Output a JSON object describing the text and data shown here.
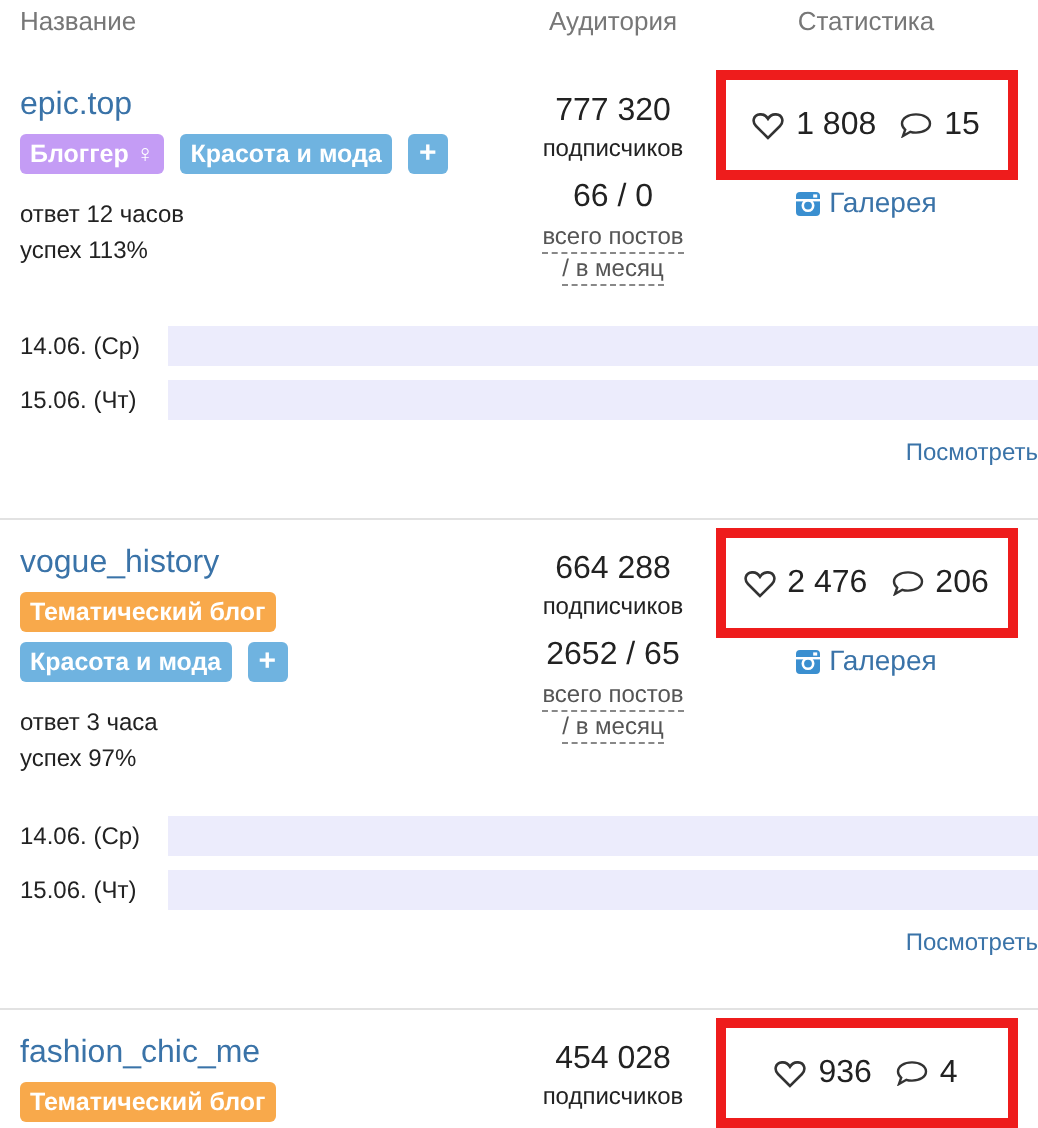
{
  "columns": [
    "Название",
    "Аудитория",
    "Статистика"
  ],
  "rows": [
    {
      "name": "epic.top",
      "tags": [
        {
          "label": "Блоггер ♀",
          "color": "#c49cf5"
        },
        {
          "label": "Красота и мода",
          "color": "#6fb3e0"
        }
      ],
      "add": "+",
      "response": "ответ 12 часов",
      "success": "успех 113%",
      "followers": "777 320",
      "followers_label": "подписчиков",
      "posts": "66 / 0",
      "posts_label": "всего постов",
      "per_month_label": "/ в месяц",
      "likes": "1 808",
      "comments": "15",
      "highlighted": true,
      "gallery": "Галерея",
      "dates": [
        "14.06. (Ср)",
        "15.06. (Чт)"
      ],
      "view": "Посмотреть"
    },
    {
      "name": "vogue_history",
      "tags": [
        {
          "label": "Тематический блог",
          "color": "#f8a94b"
        },
        {
          "label": "Красота и мода",
          "color": "#6fb3e0"
        }
      ],
      "add": "+",
      "response": "ответ 3 часа",
      "success": "успех 97%",
      "followers": "664 288",
      "followers_label": "подписчиков",
      "posts": "2652 / 65",
      "posts_label": "всего постов",
      "per_month_label": "/ в месяц",
      "likes": "2 476",
      "comments": "206",
      "highlighted": true,
      "gallery": "Галерея",
      "dates": [
        "14.06. (Ср)",
        "15.06. (Чт)"
      ],
      "view": "Посмотреть"
    },
    {
      "name": "fashion_chic_me",
      "tags": [
        {
          "label": "Тематический блог",
          "color": "#f8a94b"
        }
      ],
      "followers": "454 028",
      "followers_label": "подписчиков",
      "likes": "936",
      "comments": "4",
      "highlighted": true
    }
  ]
}
